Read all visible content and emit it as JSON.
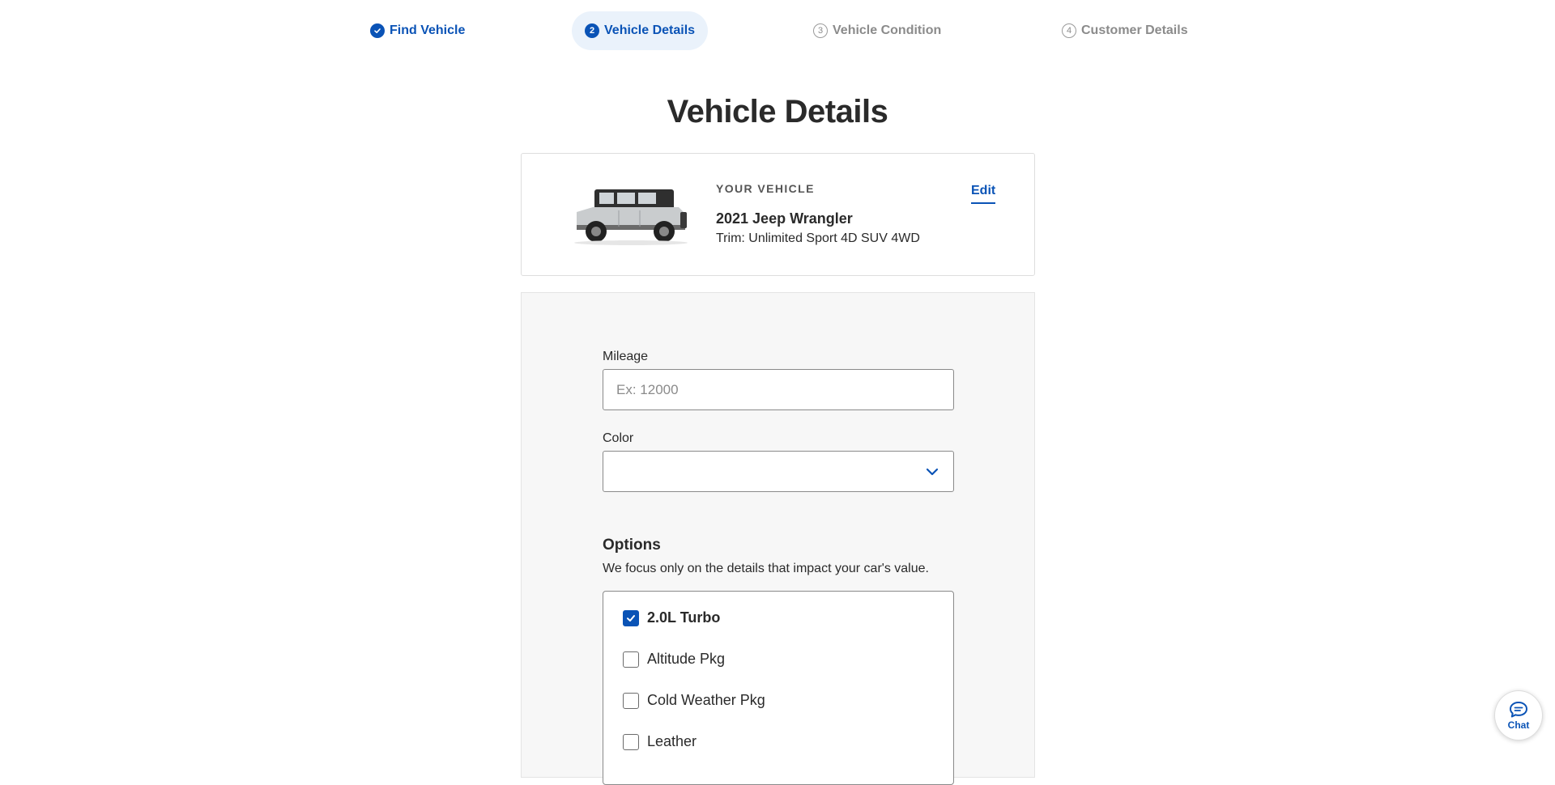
{
  "stepper": {
    "steps": [
      {
        "num": "✓",
        "label": "Find Vehicle",
        "state": "done"
      },
      {
        "num": "2",
        "label": "Vehicle Details",
        "state": "active"
      },
      {
        "num": "3",
        "label": "Vehicle Condition",
        "state": "todo"
      },
      {
        "num": "4",
        "label": "Customer Details",
        "state": "todo"
      }
    ]
  },
  "page": {
    "title": "Vehicle Details"
  },
  "vehicle": {
    "section_label": "YOUR VEHICLE",
    "name": "2021 Jeep Wrangler",
    "trim": "Trim: Unlimited Sport 4D SUV 4WD",
    "edit_label": "Edit"
  },
  "form": {
    "mileage": {
      "label": "Mileage",
      "placeholder": "Ex: 12000",
      "value": ""
    },
    "color": {
      "label": "Color",
      "value": ""
    },
    "options": {
      "title": "Options",
      "subtitle": "We focus only on the details that impact your car's value.",
      "items": [
        {
          "label": "2.0L Turbo",
          "checked": true
        },
        {
          "label": "Altitude Pkg",
          "checked": false
        },
        {
          "label": "Cold Weather Pkg",
          "checked": false
        },
        {
          "label": "Leather",
          "checked": false
        }
      ]
    }
  },
  "chat": {
    "label": "Chat"
  },
  "colors": {
    "accent": "#0a53b6",
    "muted": "#8b8b8b",
    "panel_bg": "#f7f7f7"
  }
}
